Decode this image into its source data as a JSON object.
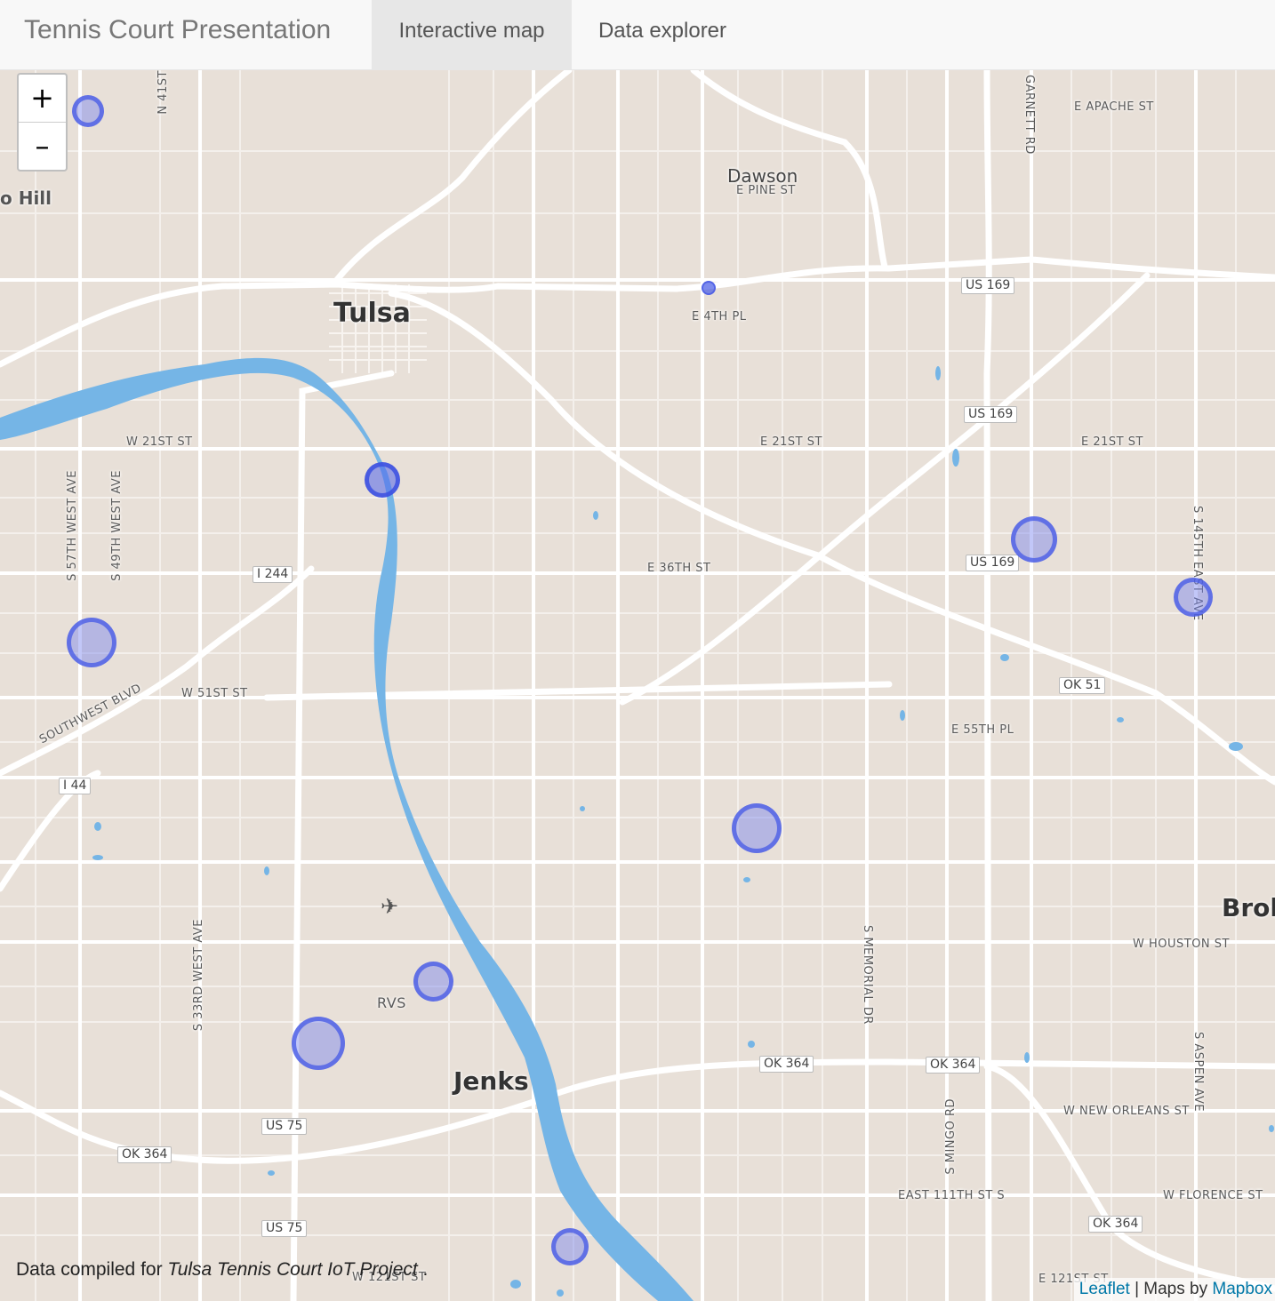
{
  "navbar": {
    "brand": "Tennis Court Presentation",
    "tabs": [
      {
        "label": "Interactive map",
        "active": true
      },
      {
        "label": "Data explorer",
        "active": false
      }
    ]
  },
  "map": {
    "zoom_in": "+",
    "zoom_out": "–",
    "cities": {
      "tulsa": "Tulsa",
      "jenks": "Jenks",
      "dawson": "Dawson",
      "broken": "Brok",
      "hill": "o Hill",
      "rvs": "RVS"
    },
    "streets": {
      "e_apache": "E APACHE ST",
      "e_pine": "E PINE ST",
      "e_4th": "E 4TH PL",
      "w_21st": "W 21ST ST",
      "e_21st_a": "E 21ST ST",
      "e_21st_b": "E 21ST ST",
      "e_36th": "E 36TH ST",
      "w_51st": "W 51ST ST",
      "e_55th": "E 55TH PL",
      "southwest": "SOUTHWEST BLVD",
      "w_houston": "W HOUSTON ST",
      "w_new_orleans": "W NEW ORLEANS ST",
      "east_111th": "EAST 111TH ST S",
      "w_florence": "W FLORENCE ST",
      "w_121st": "W 121ST ST",
      "e_121st": "E 121ST ST",
      "n_41st": "N 41ST",
      "garnett": "GARNETT RD",
      "s_57th": "S 57TH WEST AVE",
      "s_49th": "S 49TH WEST AVE",
      "s_145th": "S 145TH EAST AVE",
      "s_33rd": "S 33RD WEST AVE",
      "s_memorial": "S MEMORIAL DR",
      "s_mingo": "S MINGO RD",
      "s_aspen": "S ASPEN AVE"
    },
    "shields": {
      "us169_a": "US 169",
      "us169_b": "US 169",
      "us169_c": "US 169",
      "i244": "I 244",
      "ok51": "OK 51",
      "i44": "I 44",
      "ok364_a": "OK 364",
      "ok364_b": "OK 364",
      "ok364_c": "OK 364",
      "ok364_d": "OK 364",
      "us75_a": "US 75",
      "us75_b": "US 75"
    },
    "caption_prefix": "Data compiled for ",
    "caption_project": "Tulsa Tennis Court IoT Project",
    "caption_suffix": " .",
    "attribution": {
      "leaflet": "Leaflet",
      "sep": " | Maps by ",
      "mapbox": "Mapbox"
    },
    "colors": {
      "land": "#e8e0d8",
      "water": "#75b5e6",
      "road": "#ffffff",
      "marker_stroke": "#4a5ae6",
      "marker_fill": "#8a90ec"
    }
  }
}
